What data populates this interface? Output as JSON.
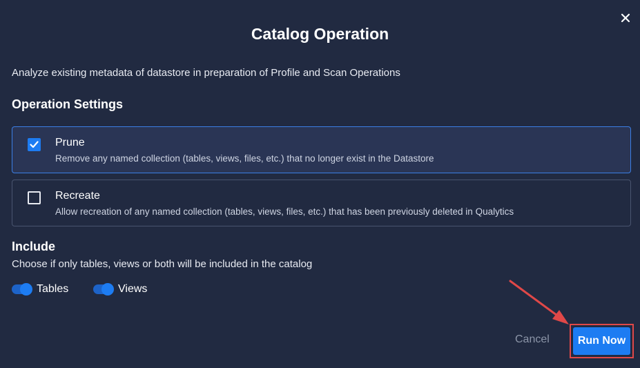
{
  "dialog": {
    "title": "Catalog Operation",
    "description": "Analyze existing metadata of datastore in preparation of Profile and Scan Operations",
    "close_icon": "close-icon"
  },
  "operation_settings": {
    "heading": "Operation Settings",
    "options": [
      {
        "label": "Prune",
        "description": "Remove any named collection (tables, views, files, etc.) that no longer exist in the Datastore",
        "checked": true
      },
      {
        "label": "Recreate",
        "description": "Allow recreation of any named collection (tables, views, files, etc.) that has been previously deleted in Qualytics",
        "checked": false
      }
    ]
  },
  "include": {
    "heading": "Include",
    "description": "Choose if only tables, views or both will be included in the catalog",
    "toggles": [
      {
        "label": "Tables",
        "on": true
      },
      {
        "label": "Views",
        "on": true
      }
    ]
  },
  "footer": {
    "cancel_label": "Cancel",
    "run_label": "Run Now"
  },
  "colors": {
    "background": "#212a41",
    "accent": "#1d7cf2",
    "highlight": "#e04848"
  }
}
